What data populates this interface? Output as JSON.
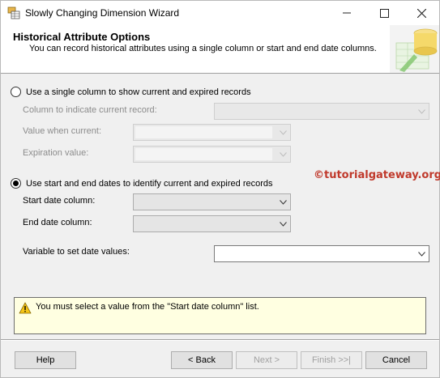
{
  "window": {
    "title": "Slowly Changing Dimension Wizard"
  },
  "header": {
    "title": "Historical Attribute Options",
    "subtitle": "You can record historical attributes using a single column or start and end date columns."
  },
  "options": {
    "single_column": {
      "label": "Use a single column to show current and expired records",
      "checked": false,
      "current_record_label": "Column to indicate current record:",
      "value_when_current_label": "Value when current:",
      "expiration_value_label": "Expiration value:"
    },
    "date_columns": {
      "label": "Use start and end dates to identify current and expired records",
      "checked": true,
      "start_date_label": "Start date column:",
      "end_date_label": "End date column:",
      "variable_label": "Variable to set date values:"
    }
  },
  "watermark": "©tutorialgateway.org",
  "message": {
    "text": "You must select a value from the \"Start date column\" list."
  },
  "buttons": {
    "help": "Help",
    "back": "< Back",
    "next": "Next >",
    "finish": "Finish >>|",
    "cancel": "Cancel"
  }
}
